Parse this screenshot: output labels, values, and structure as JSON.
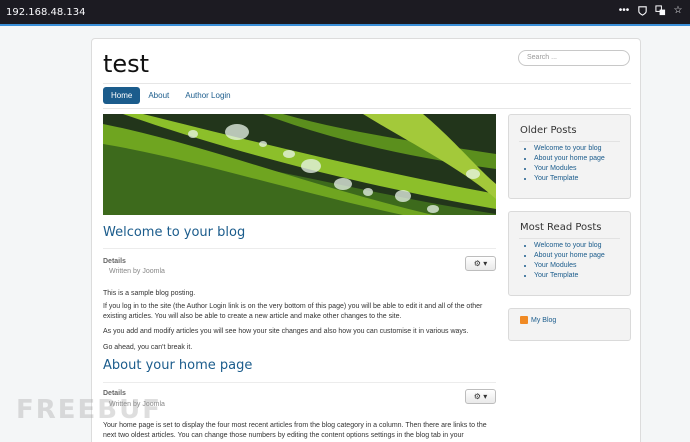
{
  "browser": {
    "url": "192.168.48.134"
  },
  "site": {
    "title": "test",
    "search_placeholder": "Search ..."
  },
  "nav": [
    "Home",
    "About",
    "Author Login"
  ],
  "articles": [
    {
      "title": "Welcome to your blog",
      "details": "Details",
      "author": "Written by Joomla",
      "paragraphs": [
        "This is a sample blog posting.",
        "If you log in to the site (the Author Login link is on the very bottom of this page) you will be able to edit it and all of the other existing articles. You will also be able to create a new article and make other changes to the site.",
        "As you add and modify articles you will see how your site changes and also how you can customise it in various ways.",
        "Go ahead, you can't break it."
      ]
    },
    {
      "title": "About your home page",
      "details": "Details",
      "author": "Written by Joomla",
      "paragraphs": [
        "Your home page is set to display the four most recent articles from the blog category in a column. Then there are links to the next two oldest articles. You can change those numbers by editing the content options settings in the blog tab in your"
      ]
    }
  ],
  "sidebar": {
    "older_posts": {
      "title": "Older Posts",
      "items": [
        "Welcome to your blog",
        "About your home page",
        "Your Modules",
        "Your Template"
      ]
    },
    "most_read": {
      "title": "Most Read Posts",
      "items": [
        "Welcome to your blog",
        "About your home page",
        "Your Modules",
        "Your Template"
      ]
    },
    "feed": {
      "label": "My Blog"
    }
  },
  "watermark": "FREEBUF",
  "colors": {
    "link": "#1b5c8c",
    "accent_bar": "#3a8fd8"
  },
  "icons": [
    "dots-icon",
    "shield-icon",
    "translate-icon",
    "star-icon",
    "gear-icon",
    "caret-down-icon",
    "rss-icon"
  ]
}
